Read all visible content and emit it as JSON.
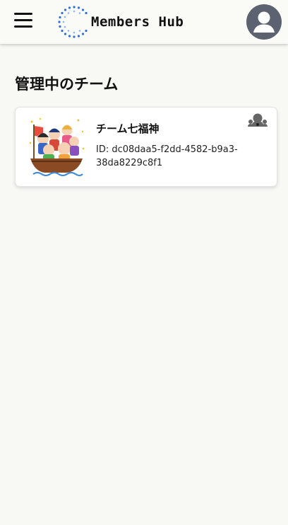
{
  "header": {
    "menu_icon": "hamburger-menu-icon",
    "logo_icon": "dotted-ring-logo",
    "app_name": "Members Hub",
    "avatar_icon": "user-avatar-icon"
  },
  "main": {
    "page_title": "管理中のチーム",
    "teams": [
      {
        "name": "チーム七福神",
        "id_label": "ID: dc08daa5-f2dd-4582-b9a3-38da8229c8f1",
        "image": "seven-lucky-gods-boat-illustration",
        "members_icon": "group-members-icon"
      }
    ]
  },
  "colors": {
    "background": "#f8f8f5",
    "header_bg": "#fafaf7",
    "avatar_bg": "#5d6270",
    "logo_blue": "#2f6fd6",
    "text": "#111111"
  }
}
